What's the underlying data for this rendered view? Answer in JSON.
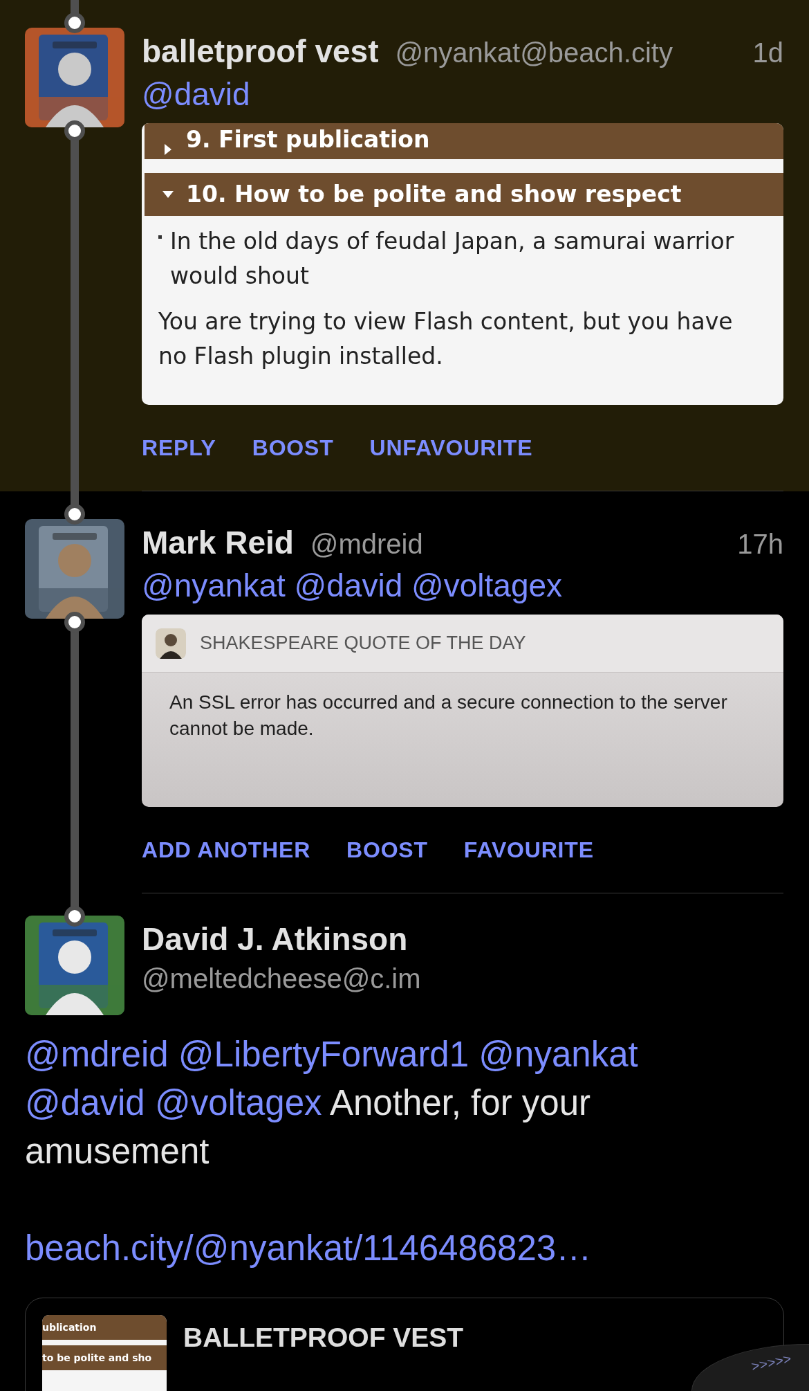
{
  "posts": [
    {
      "author": "balletproof vest",
      "handle": "@nyankat@beach.city",
      "time": "1d",
      "highlighted": true,
      "kind": "reply",
      "thread_above": true,
      "thread_below": true,
      "mentions": [
        "@david"
      ],
      "card": {
        "kind": "webpage",
        "rows": [
          {
            "kind": "header",
            "expanded": false,
            "text": "9. First publication"
          },
          {
            "kind": "header",
            "expanded": true,
            "text": "10. How to be polite and show respect"
          },
          {
            "kind": "bullet",
            "text": "In the old days of feudal Japan, a samurai warrior would shout"
          },
          {
            "kind": "paragraph",
            "text": "You are trying to view Flash content, but you have no Flash plugin installed."
          }
        ]
      },
      "actions": [
        "REPLY",
        "BOOST",
        "UNFAVOURITE"
      ]
    },
    {
      "author": "Mark Reid",
      "handle": "@mdreid",
      "time": "17h",
      "highlighted": false,
      "kind": "reply",
      "thread_above": true,
      "thread_below": true,
      "mentions": [
        "@nyankat",
        "@david",
        "@voltagex"
      ],
      "card": {
        "kind": "notification",
        "app_name": "SHAKESPEARE QUOTE OF THE DAY",
        "message": "An SSL error has occurred and a secure connection to the server cannot be made."
      },
      "actions": [
        "ADD ANOTHER",
        "BOOST",
        "FAVOURITE"
      ]
    },
    {
      "author": "David J. Atkinson",
      "handle": "@meltedcheese@c.im",
      "highlighted": false,
      "kind": "focused",
      "thread_above": true,
      "thread_below": false,
      "body": [
        {
          "kind": "mention",
          "text": "@mdreid"
        },
        {
          "kind": "mention",
          "text": "@LibertyForward1"
        },
        {
          "kind": "mention",
          "text": "@nyankat"
        },
        {
          "kind": "mention",
          "text": "@david"
        },
        {
          "kind": "mention",
          "text": "@voltagex"
        },
        {
          "kind": "text",
          "text": "Another, for your amusement"
        }
      ],
      "link": "beach.city/@nyankat/1146486823…",
      "quote": {
        "title": "BALLETPROOF VEST",
        "thumbnail_lines": [
          "ublication",
          "to be polite and sho"
        ]
      }
    }
  ],
  "floating_button": {
    "label": ">>>>>"
  }
}
